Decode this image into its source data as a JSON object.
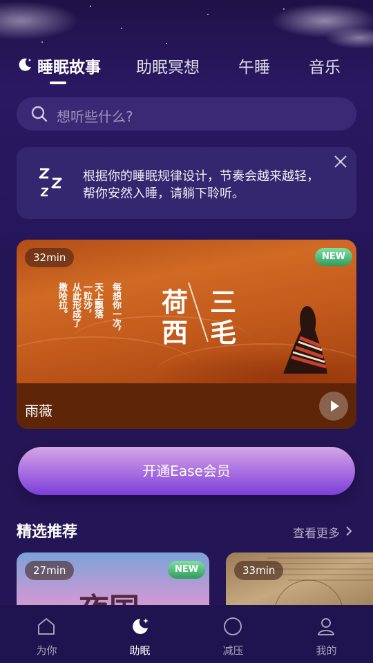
{
  "tabs": [
    {
      "label": "睡眠故事",
      "active": true
    },
    {
      "label": "助眠冥想",
      "active": false
    },
    {
      "label": "午睡",
      "active": false
    },
    {
      "label": "音乐",
      "active": false
    }
  ],
  "search": {
    "placeholder": "想听些什么?"
  },
  "tip": {
    "text": "根据你的睡眠规律设计，节奏会越来越轻，帮你安然入睡，请躺下聆听。"
  },
  "featured": {
    "duration": "32min",
    "badge": "NEW",
    "title": "雨薇",
    "art": {
      "poem_columns": [
        "每想你一次，",
        "天上飘落",
        "一粒沙，",
        "从此形成了",
        "撒哈拉。"
      ],
      "book_title_left": [
        "荷",
        "西"
      ],
      "book_title_right": [
        "三",
        "毛"
      ]
    }
  },
  "member_button": {
    "label": "开通Ease会员"
  },
  "recommend": {
    "title": "精选推荐",
    "more": "查看更多",
    "cards": [
      {
        "duration": "27min",
        "badge": "NEW",
        "art_text": "夜国"
      },
      {
        "duration": "33min"
      }
    ]
  },
  "bottom_nav": [
    {
      "label": "为你",
      "icon": "home-icon",
      "active": false
    },
    {
      "label": "助眠",
      "icon": "moon-star-icon",
      "active": true
    },
    {
      "label": "减压",
      "icon": "circle-icon",
      "active": false
    },
    {
      "label": "我的",
      "icon": "profile-icon",
      "active": false
    }
  ],
  "colors": {
    "background": "#241556",
    "card": "#352670",
    "accent": "#7b3fd8"
  }
}
